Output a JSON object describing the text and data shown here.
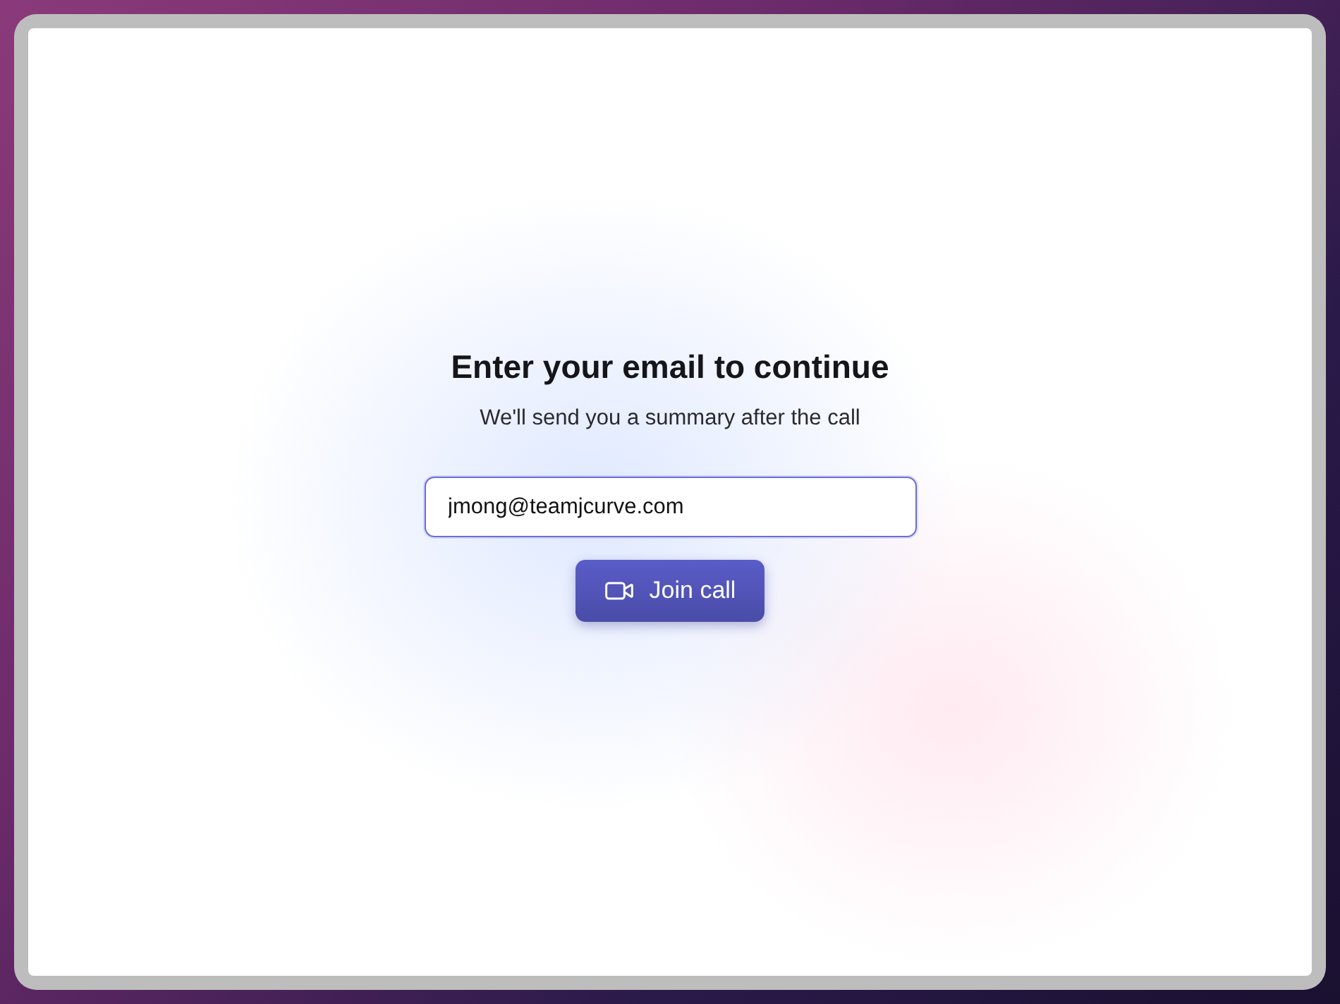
{
  "title": "Enter your email to continue",
  "subtitle": "We'll send you a summary after the call",
  "email_field": {
    "value": "jmong@teamjcurve.com"
  },
  "join_button": {
    "label": "Join call"
  }
}
